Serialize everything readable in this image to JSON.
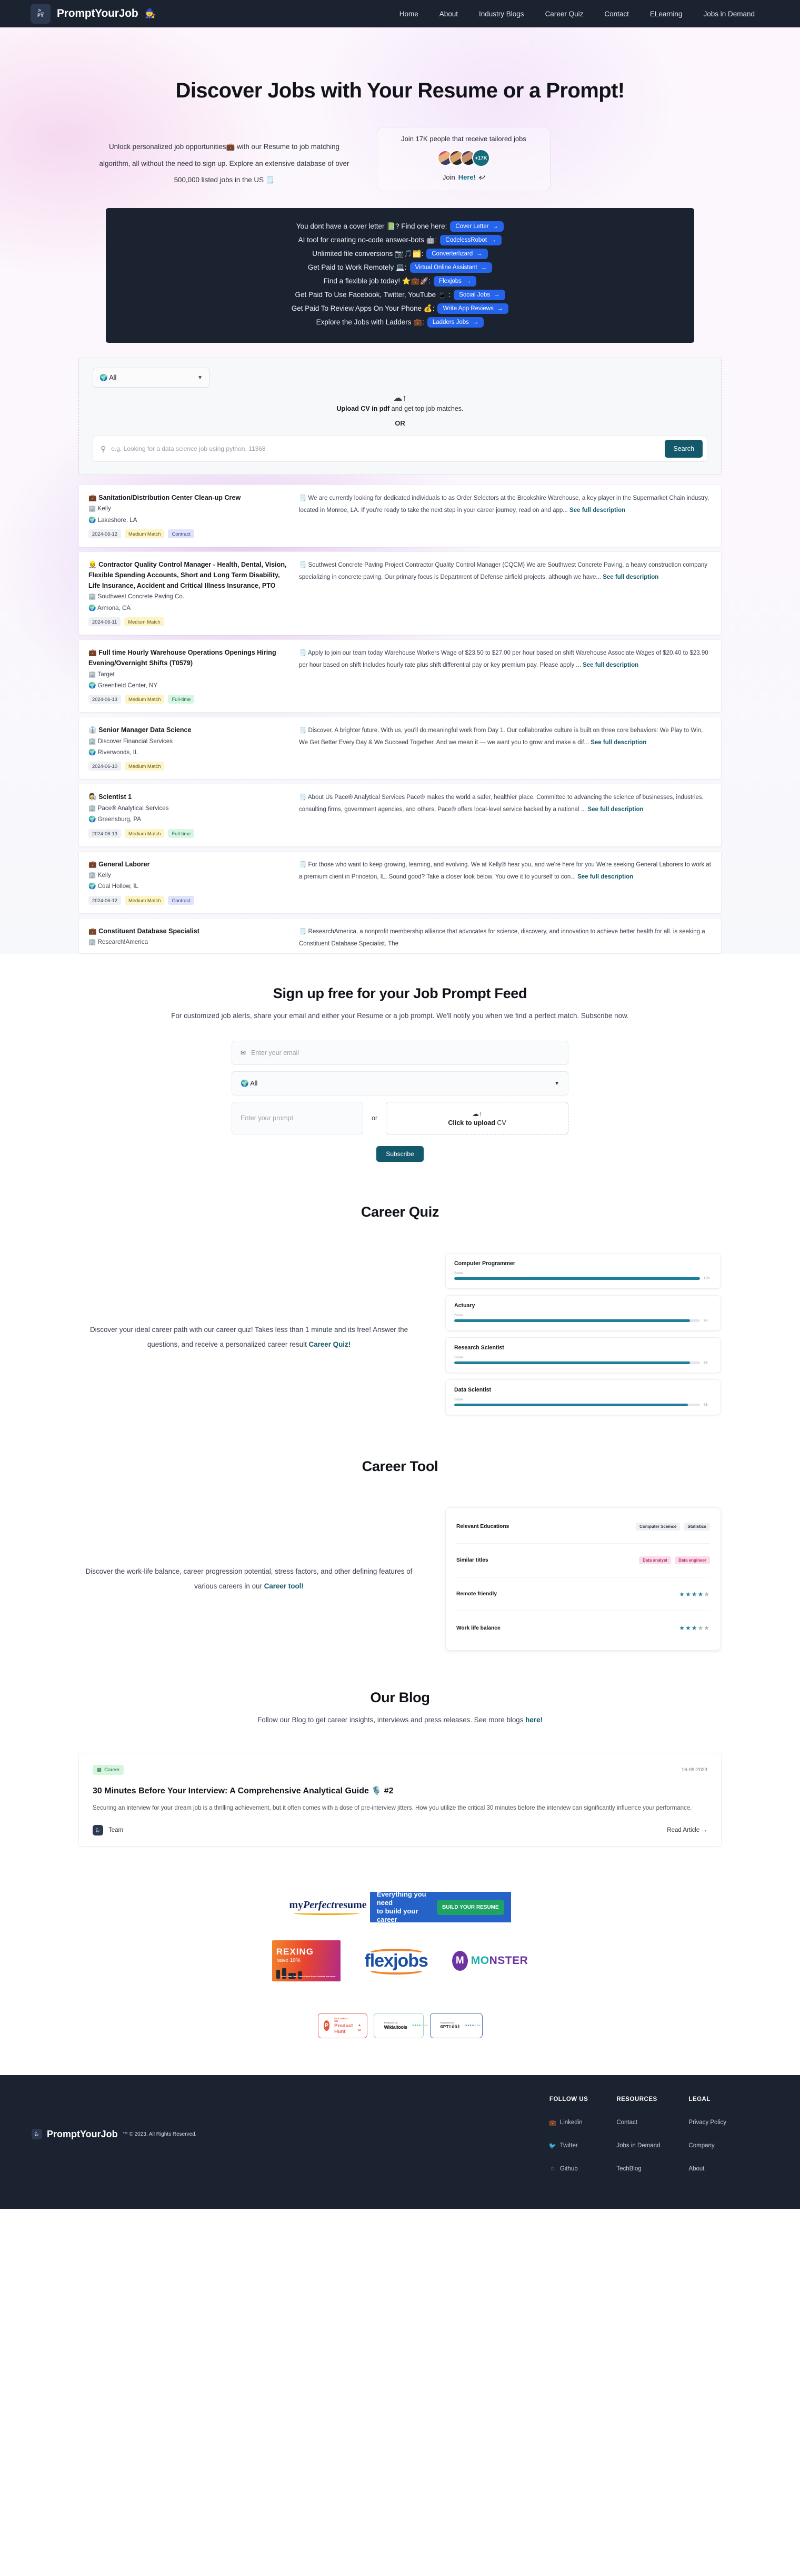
{
  "brand": {
    "name": "PromptYourJob",
    "emoji": "🧙",
    "logo_line1": ">_",
    "logo_line2": "PY"
  },
  "nav": {
    "items": [
      {
        "label": "Home"
      },
      {
        "label": "About"
      },
      {
        "label": "Industry Blogs"
      },
      {
        "label": "Career Quiz"
      },
      {
        "label": "Contact"
      },
      {
        "label": "ELearning"
      },
      {
        "label": "Jobs in Demand"
      }
    ]
  },
  "hero": {
    "title": "Discover Jobs with Your Resume or a Prompt!",
    "subtitle": "Unlock personalized job opportunities💼 with our Resume to job matching algorithm, all without the need to sign up. Explore an extensive database of over 500,000 listed jobs in the US 🗒️",
    "join_card": {
      "title": "Join 17K people that receive tailored jobs",
      "avatar_count": "+17K",
      "join_prefix": "Join",
      "join_link": "Here!"
    }
  },
  "features": [
    {
      "text": "You dont have a cover letter 📗? Find one here:",
      "pill": "Cover Letter"
    },
    {
      "text": "AI tool for creating no-code answer-bots 🤖:",
      "pill": "CodelessRobot"
    },
    {
      "text": "Unlimited file conversions 📷🎵🗂️:",
      "pill": "Converterlizard"
    },
    {
      "text": "Get Paid to Work Remotely 💻:",
      "pill": "Virtual Online Assistant"
    },
    {
      "text": "Find a flexible job today! ⭐💼🚀:",
      "pill": "Flexjobs"
    },
    {
      "text": "Get Paid To Use Facebook, Twitter, YouTube 📱 :",
      "pill": "Social Jobs"
    },
    {
      "text": "Get Paid To Review Apps On Your Phone 💰:",
      "pill": "Write App Reviews"
    },
    {
      "text": "Explore the Jobs with Ladders 💼:",
      "pill": "Ladders Jobs"
    }
  ],
  "search": {
    "country_selected": "🌍 All",
    "upload_bold": "Upload CV in pdf",
    "upload_rest": " and get top job matches.",
    "or": "OR",
    "placeholder": "e.g. Looking for a data science job using python, 11368",
    "button": "Search"
  },
  "jobs": [
    {
      "title": "💼 Sanitation/Distribution Center Clean-up Crew",
      "company": "🏢 Kelly",
      "location": "🌍 Lakeshore, LA",
      "date": "2024-06-12",
      "match": "Medium Match",
      "type": "Contract",
      "type_class": "tag-type-contract",
      "description": "🗒️ We are currently looking for dedicated individuals to as Order Selectors at the Brookshire Warehouse, a key player in the Supermarket Chain industry, located in Monroe, LA. If you're ready to take the next step in your career journey, read on and app...",
      "link": "See full description"
    },
    {
      "title": "👷 Contractor Quality Control Manager - Health, Dental, Vision, Flexible Spending Accounts, Short and Long Term Disability, Life Insurance, Accident and Critical Illness Insurance, PTO",
      "company": "🏢 Southwest Concrete Paving Co.",
      "location": "🌍 Armona, CA",
      "date": "2024-06-11",
      "match": "Medium Match",
      "type": "",
      "type_class": "",
      "description": "🗒️ Southwest Concrete Paving Project Contractor Quality Control Manager (CQCM) We are Southwest Concrete Paving, a heavy construction company specializing in concrete paving. Our primary focus is Department of Defense airfield projects, although we have...",
      "link": "See full description"
    },
    {
      "title": "💼 Full time Hourly Warehouse Operations Openings Hiring Evening/Overnight Shifts (T0579)",
      "company": "🏢 Target",
      "location": "🌍 Greenfield Center, NY",
      "date": "2024-06-13",
      "match": "Medium Match",
      "type": "Full-time",
      "type_class": "tag-type-full",
      "description": "🗒️ Apply to join our team today Warehouse Workers Wage of $23.50 to $27.00 per hour based on shift Warehouse Associate Wages of $20.40 to $23.90 per hour based on shift Includes hourly rate plus shift differential pay or key premium pay. Please apply ...",
      "link": "See full description"
    },
    {
      "title": "👔 Senior Manager Data Science",
      "company": "🏢 Discover Financial Services",
      "location": "🌍 Riverwoods, IL",
      "date": "2024-06-10",
      "match": "Medium Match",
      "type": "",
      "type_class": "",
      "description": "🗒️ Discover. A brighter future. With us, you'll do meaningful work from Day 1. Our collaborative culture is built on three core behaviors: We Play to Win, We Get Better Every Day & We Succeed Together. And we mean it — we want you to grow and make a dif...",
      "link": "See full description"
    },
    {
      "title": "👩‍🔬 Scientist 1",
      "company": "🏢 Pace® Analytical Services",
      "location": "🌍 Greensburg, PA",
      "date": "2024-06-13",
      "match": "Medium Match",
      "type": "Full-time",
      "type_class": "tag-type-full",
      "description": "🗒️ About Us Pace® Analytical Services Pace® makes the world a safer, healthier place. Committed to advancing the science of businesses, industries, consulting firms, government agencies, and others, Pace® offers local-level service backed by a national ...",
      "link": "See full description"
    },
    {
      "title": "💼 General Laborer",
      "company": "🏢 Kelly",
      "location": "🌍 Coal Hollow, IL",
      "date": "2024-06-12",
      "match": "Medium Match",
      "type": "Contract",
      "type_class": "tag-type-contract",
      "description": "🗒️ For those who want to keep growing, learning, and evolving. We at Kelly® hear you, and we're here for you We're seeking General Laborers to work at a premium client in Princeton, IL. Sound good? Take a closer look below. You owe it to yourself to con...",
      "link": "See full description"
    },
    {
      "title": "💼 Constituent Database Specialist",
      "company": "🏢 Research!America",
      "location": "",
      "date": "",
      "match": "",
      "type": "",
      "type_class": "",
      "description": "🗒️ ResearchAmerica, a nonprofit membership alliance that advocates for science, discovery, and innovation to achieve better health for all. is seeking a Constituent Database Specialist. The",
      "link": ""
    }
  ],
  "signup": {
    "title": "Sign up free for your Job Prompt Feed",
    "subtitle": "For customized job alerts, share your email and either your Resume or a job prompt. We'll notify you when we find a perfect match. Subscribe now.",
    "email_placeholder": "Enter your email",
    "country_selected": "🌍 All",
    "prompt_placeholder": "Enter your prompt",
    "or": "or",
    "upload_bold": "Click to upload",
    "upload_rest": " CV",
    "button": "Subscribe"
  },
  "quiz": {
    "title": "Career Quiz",
    "text_plain": "Discover your ideal career path with our career quiz! Takes less than 1 minute and its free! Answer the questions, and receive a personalized career result ",
    "text_link": "Career Quiz!",
    "score_label": "Score"
  },
  "tool": {
    "title": "Career Tool",
    "text_plain": "Discover the work-life balance, career progression potential, stress factors, and other defining features of various careers in our ",
    "text_link": "Career tool!",
    "rows": [
      {
        "label": "Relevant Educations",
        "chips": [
          "Computer Science",
          "Statistics"
        ],
        "chip_class": "chip-grey",
        "stars": 0
      },
      {
        "label": "Similar titles",
        "chips": [
          "Data analyst",
          "Data engineer"
        ],
        "chip_class": "chip-pink",
        "stars": 0
      },
      {
        "label": "Remote friendly",
        "chips": [],
        "chip_class": "",
        "stars": 4
      },
      {
        "label": "Work life balance",
        "chips": [],
        "chip_class": "",
        "stars": 3
      }
    ]
  },
  "blog": {
    "title": "Our Blog",
    "sub_plain": "Follow our Blog to get career insights, interviews and press releases. See more blogs ",
    "sub_link": "here!",
    "category": "Career",
    "date": "16-09-2023",
    "post_title": "30 Minutes Before Your Interview: A Comprehensive Analytical Guide 🎙️ #2",
    "excerpt": "Securing an interview for your dream job is a thrilling achievement, but it often comes with a dose of pre-interview jitters. How you utilize the critical 30 minutes before the interview can significantly influence your performance.",
    "author": "Team",
    "read": "Read Article →"
  },
  "partners": {
    "myperfectresume": {
      "pre": "my",
      "mid": "Perfect",
      "post": "resume"
    },
    "banner": {
      "line1": "Everything you need",
      "line2": "to build your career",
      "cta": "BUILD YOUR RESUME"
    },
    "rexing": {
      "word": "REXING",
      "save": "save 10%",
      "items": "Dash Cams\nTrail Cams\nSmart Home Devices\nAnd more..."
    },
    "flexjobs": {
      "word": "flexjobs"
    },
    "monster": {
      "glyph": "M",
      "word": "M",
      "word_rest": "NSTER",
      "word_o": "O"
    }
  },
  "badges": [
    {
      "id": "product-hunt",
      "featured": "FEATURED ON",
      "name": "Product Hunt",
      "count": "82"
    },
    {
      "id": "wikiaitools",
      "featured": "Featured on",
      "name": "Wikiaitools",
      "stars": "★★★★☆ 4.5"
    },
    {
      "id": "gpttool",
      "featured": "Featured on",
      "name": "GPTtööl",
      "stars": "★★★★☆ 4.4"
    }
  ],
  "footer": {
    "brand": "PromptYourJob",
    "copyright": "™ © 2023. All Rights Reserved.",
    "columns": [
      {
        "heading": "FOLLOW US",
        "links": [
          {
            "label": "Linkedin",
            "icon": "in"
          },
          {
            "label": "Twitter",
            "icon": "🐦"
          },
          {
            "label": "Github",
            "icon": "Ⓖ"
          }
        ]
      },
      {
        "heading": "RESOURCES",
        "links": [
          {
            "label": "Contact",
            "icon": ""
          },
          {
            "label": "Jobs in Demand",
            "icon": ""
          },
          {
            "label": "TechBlog",
            "icon": ""
          }
        ]
      },
      {
        "heading": "LEGAL",
        "links": [
          {
            "label": "Privacy Policy",
            "icon": ""
          },
          {
            "label": "Company",
            "icon": ""
          },
          {
            "label": "About",
            "icon": ""
          }
        ]
      }
    ]
  },
  "chart_data": {
    "type": "bar",
    "title": "Career Quiz",
    "orientation": "horizontal",
    "categories": [
      "Computer Programmer",
      "Actuary",
      "Research Scientist",
      "Data Scientist"
    ],
    "values": [
      100,
      96,
      96,
      95
    ],
    "value_label": "Score",
    "xlim": [
      0,
      100
    ],
    "grid": false,
    "legend": "none",
    "accent_color": "#1d7f99"
  }
}
